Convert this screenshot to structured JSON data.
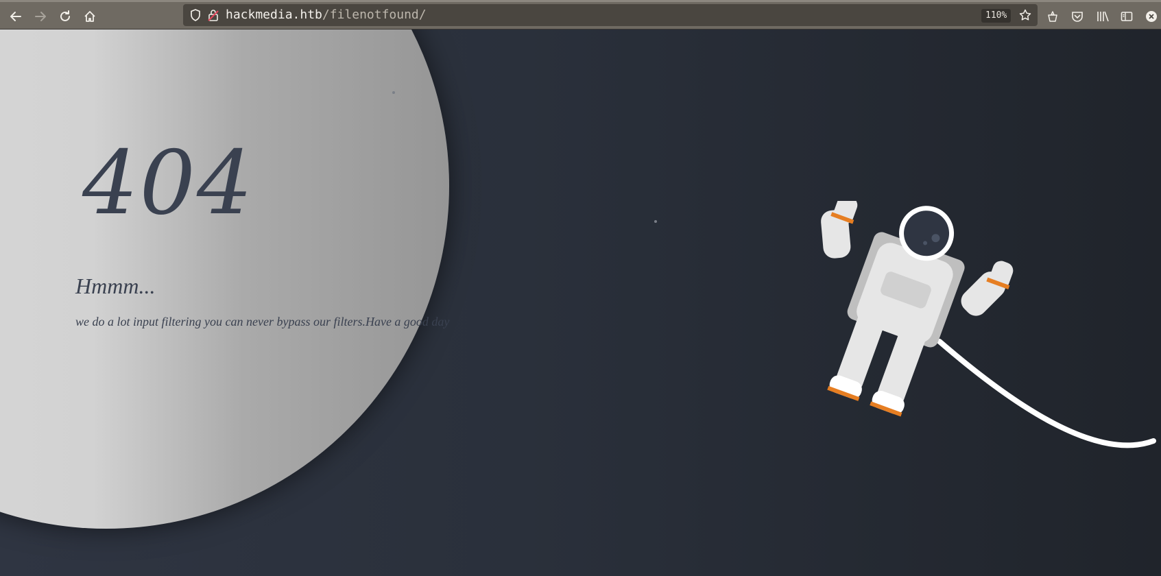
{
  "browser": {
    "url_host": "hackmedia.htb",
    "url_path": "/filenotfound/",
    "zoom": "110%",
    "icons": {
      "back": "back-arrow-icon",
      "forward": "forward-arrow-icon",
      "reload": "reload-icon",
      "home": "home-icon",
      "shield": "tracking-shield-icon",
      "lock": "insecure-lock-icon",
      "bookmark": "star-icon",
      "extension": "extension-icon",
      "pocket": "pocket-icon",
      "library": "library-icon",
      "sidebar": "sidebar-icon",
      "close": "close-icon"
    }
  },
  "error": {
    "code": "404",
    "heading": "Hmmm...",
    "message": "we do a lot input filtering you can never bypass our filters.Have a good day"
  },
  "colors": {
    "text": "#3a4150",
    "accent_orange": "#e67e22",
    "suit": "#e6e6e6"
  }
}
